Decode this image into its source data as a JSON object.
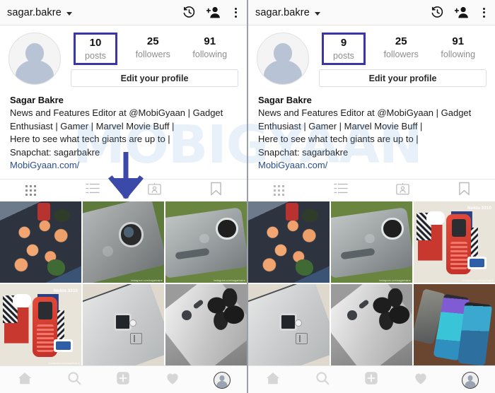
{
  "watermark": {
    "text": "MOBIGYAAN"
  },
  "theme": {
    "highlight_box": "#3b36a8",
    "annotation_arrow": "#3b4aa8",
    "link_text": "#2b4d8c",
    "muted_text": "#8e8e8e",
    "header_bg": "#fafafa"
  },
  "panels": [
    {
      "id": "before",
      "header": {
        "username": "sagar.bakre",
        "icons": [
          "history-icon",
          "add-person-icon",
          "overflow-menu-icon"
        ]
      },
      "profile": {
        "avatar": "default-avatar",
        "stats": [
          {
            "num": "10",
            "label": "posts",
            "highlighted": true
          },
          {
            "num": "25",
            "label": "followers",
            "highlighted": false
          },
          {
            "num": "91",
            "label": "following",
            "highlighted": false
          }
        ],
        "edit_button": "Edit your profile",
        "display_name": "Sagar Bakre",
        "bio_lines": [
          "News and Features Editor at @MobiGyaan | Gadget",
          "Enthusiast | Gamer | Marvel Movie Buff |",
          "Here to see what tech giants are up to |",
          "Snapchat: sagarbakre"
        ],
        "website": "MobiGyaan.com/"
      },
      "tabs": [
        {
          "name": "grid-tab",
          "icon": "grid-icon",
          "active": true
        },
        {
          "name": "list-tab",
          "icon": "list-icon",
          "active": false
        },
        {
          "name": "tagged-tab",
          "icon": "tagged-person-icon",
          "active": false
        },
        {
          "name": "saved-tab",
          "icon": "bookmark-icon",
          "active": false
        }
      ],
      "grid": [
        {
          "name": "post-sushi",
          "art": "art-sushi",
          "caption": ""
        },
        {
          "name": "post-moto-z2-top",
          "art": "art-motoA",
          "caption": "instagram.com/sagarbakre"
        },
        {
          "name": "post-moto-z2-side",
          "art": "art-motoB",
          "caption": "instagram.com/sagarbakre"
        },
        {
          "name": "post-nokia-3310",
          "art": "art-nokia",
          "caption": "instagram.com/sagarbakre",
          "label": "Nokia 3310"
        },
        {
          "name": "post-oneplus",
          "art": "art-op",
          "caption": ""
        },
        {
          "name": "post-xperia-xz",
          "art": "art-xz",
          "caption": ""
        }
      ],
      "bottom_nav": [
        {
          "name": "nav-home",
          "icon": "home-icon"
        },
        {
          "name": "nav-search",
          "icon": "search-icon"
        },
        {
          "name": "nav-add-post",
          "icon": "plus-square-icon"
        },
        {
          "name": "nav-activity",
          "icon": "heart-icon"
        },
        {
          "name": "nav-profile",
          "icon": "profile-avatar-icon"
        }
      ]
    },
    {
      "id": "after",
      "header": {
        "username": "sagar.bakre",
        "icons": [
          "history-icon",
          "add-person-icon",
          "overflow-menu-icon"
        ]
      },
      "profile": {
        "avatar": "default-avatar",
        "stats": [
          {
            "num": "9",
            "label": "posts",
            "highlighted": true
          },
          {
            "num": "25",
            "label": "followers",
            "highlighted": false
          },
          {
            "num": "91",
            "label": "following",
            "highlighted": false
          }
        ],
        "edit_button": "Edit your profile",
        "display_name": "Sagar Bakre",
        "bio_lines": [
          "News and Features Editor at @MobiGyaan | Gadget",
          "Enthusiast | Gamer | Marvel Movie Buff |",
          "Here to see what tech giants are up to |",
          "Snapchat: sagarbakre"
        ],
        "website": "MobiGyaan.com/"
      },
      "tabs": [
        {
          "name": "grid-tab",
          "icon": "grid-icon",
          "active": false
        },
        {
          "name": "list-tab",
          "icon": "list-icon",
          "active": false
        },
        {
          "name": "tagged-tab",
          "icon": "tagged-person-icon",
          "active": false
        },
        {
          "name": "saved-tab",
          "icon": "bookmark-icon",
          "active": false
        }
      ],
      "grid": [
        {
          "name": "post-sushi",
          "art": "art-sushi",
          "caption": ""
        },
        {
          "name": "post-moto-z2-side",
          "art": "art-motoB",
          "caption": "instagram.com/sagarbakre"
        },
        {
          "name": "post-nokia-3310",
          "art": "art-nokia",
          "caption": "instagram.com/sagarbakre",
          "label": "Nokia 3310"
        },
        {
          "name": "post-oneplus",
          "art": "art-op",
          "caption": ""
        },
        {
          "name": "post-xperia-xz",
          "art": "art-xz",
          "caption": ""
        },
        {
          "name": "post-lg-phones",
          "art": "art-lg",
          "caption": ""
        }
      ],
      "bottom_nav": [
        {
          "name": "nav-home",
          "icon": "home-icon"
        },
        {
          "name": "nav-search",
          "icon": "search-icon"
        },
        {
          "name": "nav-add-post",
          "icon": "plus-square-icon"
        },
        {
          "name": "nav-activity",
          "icon": "heart-icon"
        },
        {
          "name": "nav-profile",
          "icon": "profile-avatar-icon"
        }
      ]
    }
  ]
}
